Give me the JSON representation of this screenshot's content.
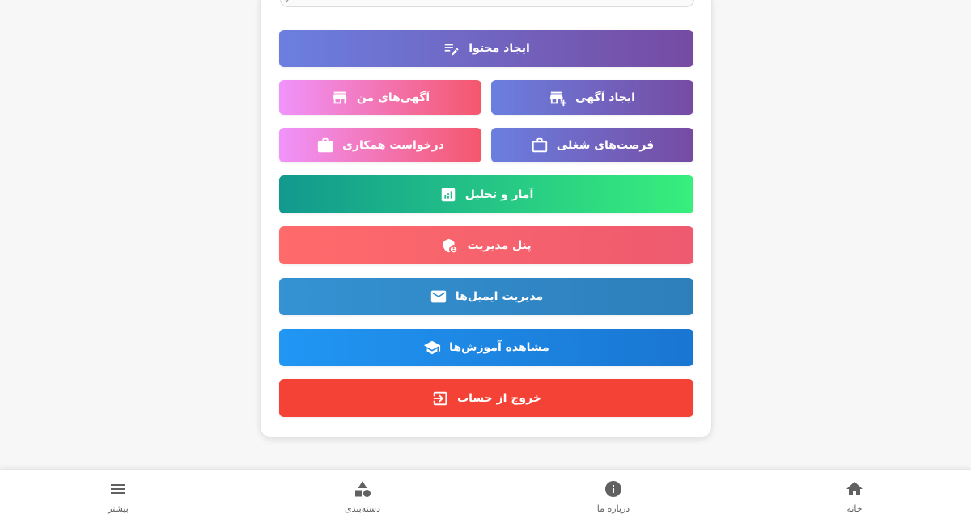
{
  "buttons": {
    "create_content": "ایجاد محتوا",
    "create_ad": "ایجاد آگهی",
    "my_ads": "آگهی‌های من",
    "job_opportunities": "فرصت‌های شغلی",
    "cooperation_request": "درخواست همکاری",
    "analytics": "آمار و تحلیل",
    "admin_panel": "پنل مدیریت",
    "email_management": "مدیریت ایمیل‌ها",
    "view_tutorials": "مشاهده آموزش‌ها",
    "logout": "خروج از حساب"
  },
  "colors": {
    "purple_start": "#6b7fe0",
    "purple_end": "#764ba2",
    "pink_start": "#f093fb",
    "pink_end": "#f5576c",
    "green_start": "#11998e",
    "green_end": "#38ef7d",
    "coral_start": "#ff6b6b",
    "coral_end": "#ee5a6f",
    "blue": "#3592d3",
    "bright_blue": "#2196f3",
    "red": "#f44336"
  },
  "bottom_nav": {
    "home": "خانه",
    "about": "درباره ما",
    "categories": "دسته‌بندی",
    "more": "بیشتر"
  }
}
